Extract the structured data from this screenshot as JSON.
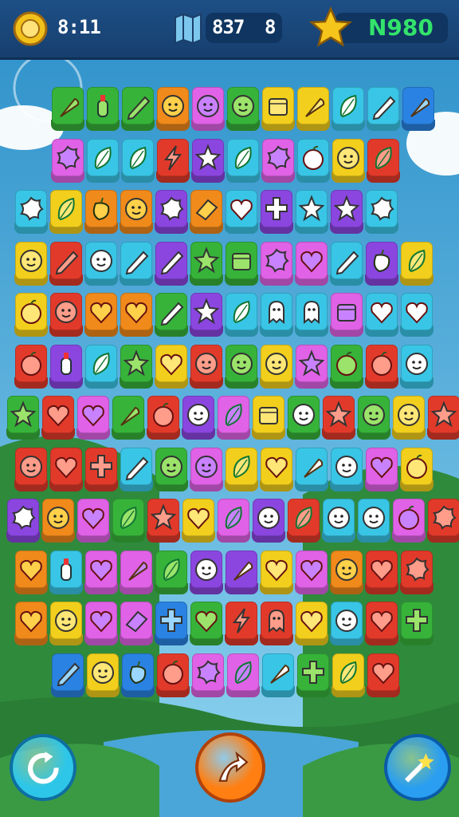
{
  "hud": {
    "left_value": "8:11",
    "center_value": "837",
    "center_value_2": "8",
    "score": "N980"
  },
  "colors": {
    "sky_top": "#2c90c9",
    "grass": "#2f8a3c",
    "hud_bg": "#1b4a80",
    "score_green": "#33e36b"
  },
  "board": {
    "palette": {
      "g": "#37b33a",
      "b": "#2a83e2",
      "o": "#f08a1b",
      "p": "#e062e6",
      "y": "#f2cf1c",
      "c": "#39c5e6",
      "v": "#8b46e0",
      "r": "#e23a2a"
    },
    "rows": [
      "gggopgyyccb",
      "pccrvcpcyr",
      "cyoovocvcvc",
      "yrccvggppcvy",
      "yrooavcccpcc",
      "rvcgyrgypgrc",
      "grpgrvpywrgyr",
      "rrrcgpyyccpy",
      "vopgrypvrccpr",
      "ocppgvvyporr",
      "oyppbgrrycrg",
      "bybrppcgyr"
    ],
    "icons": [
      [
        "carrot-icon",
        "bottle-icon",
        "pencil-icon",
        "face-icon",
        "face-icon",
        "face-icon",
        "box-icon",
        "carrot-icon",
        "leaf-icon",
        "pencil-icon"
      ],
      [
        "splat-icon",
        "leaf-icon",
        "leaf-icon",
        "bolt-icon",
        "star-icon",
        "leaf-icon",
        "splat-icon",
        "apple-icon",
        "face-icon",
        "leaf-icon"
      ],
      [
        "splat-icon",
        "leaf-icon",
        "pepper-icon",
        "face-icon",
        "splat-icon",
        "eraser-icon",
        "heart-icon",
        "cross-icon",
        "star-icon",
        "star-icon",
        "splat-icon",
        "splat-icon"
      ],
      [
        "face-icon",
        "pencil-icon",
        "face-icon",
        "pencil-icon",
        "pencil-icon",
        "star-icon",
        "box-icon",
        "splat-icon",
        "heart-icon",
        "pencil-icon",
        "pepper-icon",
        "leaf-icon"
      ],
      [
        "apple-icon",
        "face-icon",
        "heart-icon",
        "heart-icon",
        "pencil-icon",
        "star-icon",
        "leaf-icon",
        "ghost-icon",
        "ghost-icon",
        "box-icon",
        "heart-icon",
        "heart-icon"
      ],
      [
        "apple-icon",
        "bottle-icon",
        "leaf-icon",
        "star-icon",
        "heart-icon",
        "face-icon",
        "face-icon",
        "face-icon",
        "star-icon",
        "apple-icon",
        "apple-icon",
        "face-icon"
      ],
      [
        "star-icon",
        "heart-icon",
        "heart-icon",
        "carrot-icon",
        "apple-icon",
        "face-icon",
        "leaf-icon",
        "box-icon",
        "face-icon",
        "star-icon",
        "face-icon",
        "face-icon"
      ],
      [
        "face-icon",
        "heart-icon",
        "cross-icon",
        "pencil-icon",
        "face-icon",
        "face-icon",
        "leaf-icon",
        "heart-icon",
        "carrot-icon",
        "face-icon",
        "heart-icon",
        "apple-icon"
      ],
      [
        "splat-icon",
        "face-icon",
        "heart-icon",
        "leaf-icon",
        "star-icon",
        "heart-icon",
        "leaf-icon",
        "face-icon",
        "leaf-icon",
        "face-icon",
        "face-icon",
        "apple-icon"
      ],
      [
        "heart-icon",
        "bottle-icon",
        "heart-icon",
        "carrot-icon",
        "leaf-icon",
        "face-icon",
        "carrot-icon",
        "heart-icon",
        "heart-icon",
        "face-icon",
        "heart-icon",
        "splat-icon"
      ],
      [
        "heart-icon",
        "face-icon",
        "heart-icon",
        "eraser-icon",
        "cross-icon",
        "heart-icon",
        "bolt-icon",
        "ghost-icon",
        "heart-icon",
        "face-icon",
        "heart-icon",
        "cross-icon"
      ],
      [
        "pencil-icon",
        "face-icon",
        "pepper-icon",
        "apple-icon",
        "splat-icon",
        "leaf-icon",
        "carrot-icon",
        "cross-icon",
        "leaf-icon",
        "heart-icon"
      ]
    ]
  },
  "buttons": [
    {
      "name": "shuffle-button",
      "icon": "refresh-icon"
    },
    {
      "name": "hint-button",
      "icon": "arrow-icon"
    },
    {
      "name": "magic-button",
      "icon": "wand-icon"
    }
  ]
}
